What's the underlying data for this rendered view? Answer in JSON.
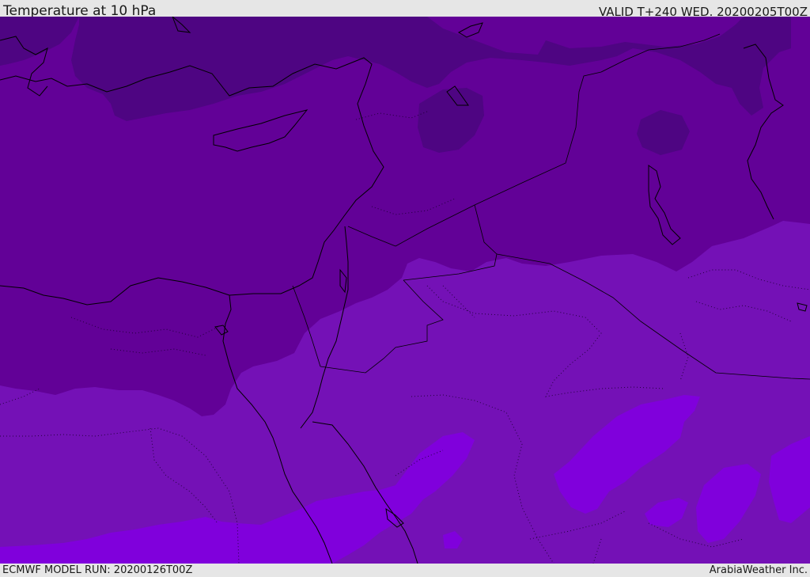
{
  "header": {
    "title": "Temperature at 10 hPa",
    "valid": "VALID T+240 WED. 20200205T00Z"
  },
  "footer": {
    "model_run": "ECMWF MODEL RUN: 20200126T00Z",
    "brand": "ArabiaWeather Inc."
  },
  "colors": {
    "band_coldest": "#4e0582",
    "band_cold": "#620197",
    "band_mid": "#7411b6",
    "band_warm": "#8000dc",
    "coastline": "#000000",
    "border": "#000000"
  }
}
